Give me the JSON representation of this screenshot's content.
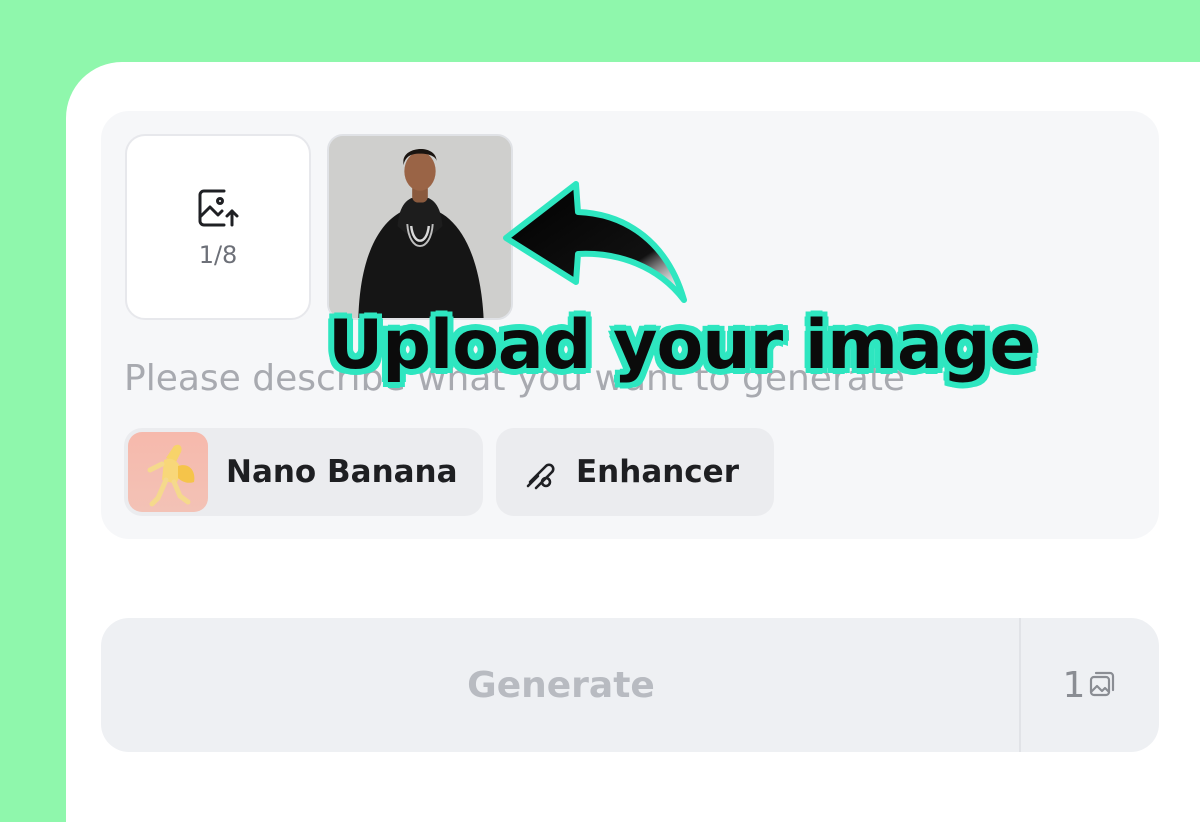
{
  "upload": {
    "count_label": "1/8",
    "icon": "image-upload-icon"
  },
  "uploaded_images": [
    {
      "icon": "uploaded-photo-thumbnail"
    }
  ],
  "prompt": {
    "placeholder": "Please describe what you want to generate"
  },
  "chips": {
    "model": {
      "label": "Nano Banana"
    },
    "enhancer": {
      "label": "Enhancer",
      "icon": "magic-wand-icon"
    }
  },
  "generate": {
    "label": "Generate",
    "image_count": "1",
    "icon": "images-icon"
  },
  "annotation": {
    "text": "Upload your image"
  },
  "colors": {
    "background": "#8ff7ac",
    "annotation_outline": "#2ee6c0",
    "generate_text": "#b8bbc1"
  }
}
